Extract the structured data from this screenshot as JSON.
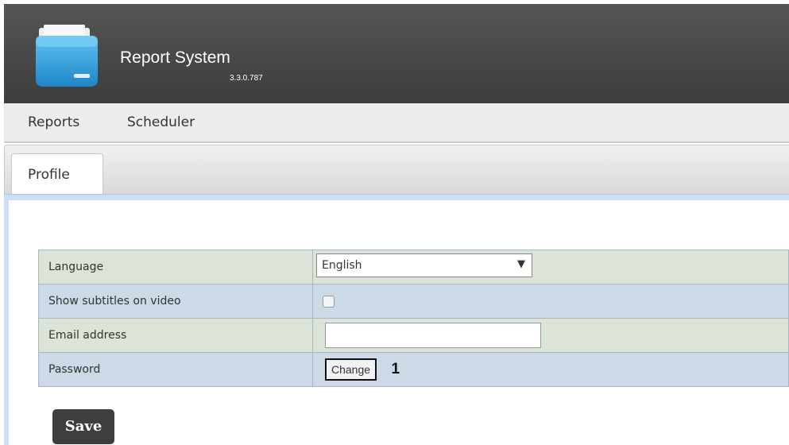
{
  "app": {
    "title": "Report System",
    "version": "3.3.0.787",
    "logo_icon": "folder-icon"
  },
  "menu": {
    "items": [
      {
        "label": "Reports"
      },
      {
        "label": "Scheduler"
      }
    ]
  },
  "tabs": [
    {
      "label": "Profile",
      "active": true
    }
  ],
  "form": {
    "rows": [
      {
        "label": "Language",
        "control": "select",
        "value": "English",
        "arrow": "▼"
      },
      {
        "label": "Show subtitles on video",
        "control": "checkbox",
        "checked": false
      },
      {
        "label": "Email address",
        "control": "text",
        "value": ""
      },
      {
        "label": "Password",
        "control": "button",
        "button_label": "Change",
        "callout": "1"
      }
    ]
  },
  "actions": {
    "save_label": "Save"
  },
  "colors": {
    "header_bg": "#474747",
    "row_green": "#dbe4d6",
    "row_blue": "#ccd9e6",
    "tab_strip": "#cde0f3",
    "save_bg": "#3e3e3e"
  }
}
